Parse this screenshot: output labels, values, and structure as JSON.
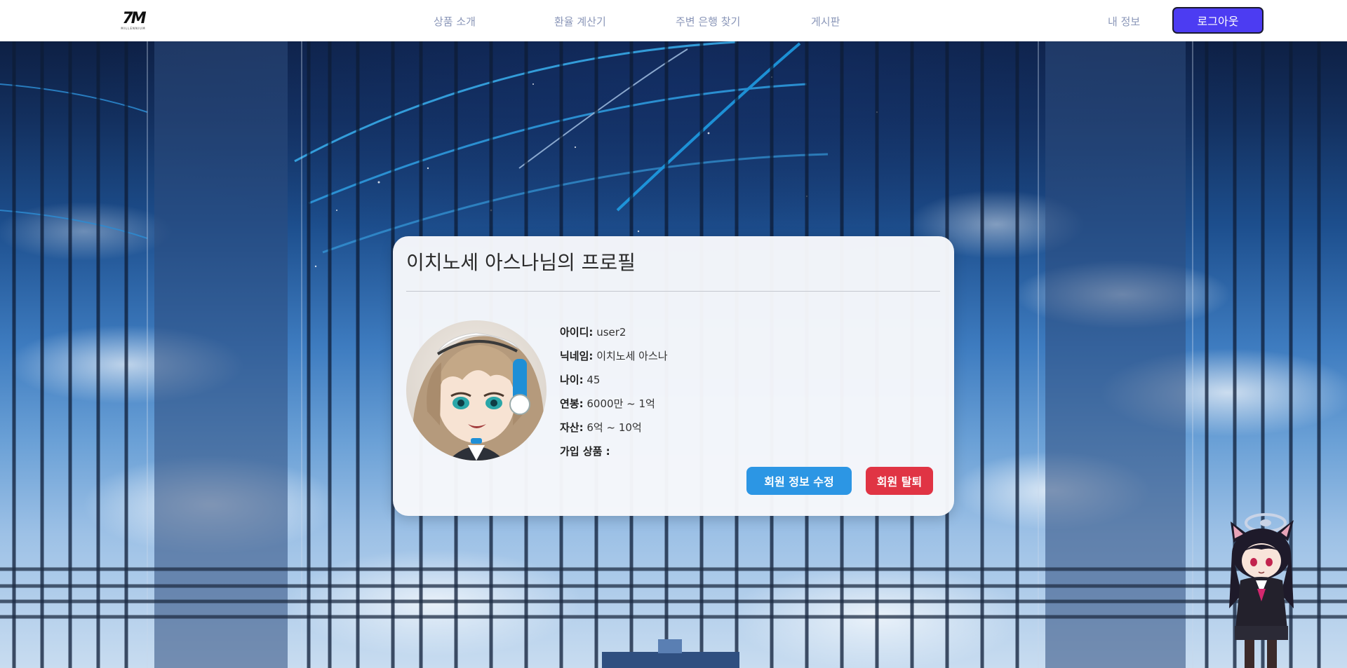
{
  "header": {
    "logo": {
      "mark": "7M",
      "sub": "MILLENNIUM"
    },
    "nav": [
      {
        "label": "상품 소개"
      },
      {
        "label": "환율 계산기"
      },
      {
        "label": "주변 은행 찾기"
      },
      {
        "label": "게시판"
      }
    ],
    "my_info_label": "내 정보",
    "logout_label": "로그아웃"
  },
  "profile": {
    "title": "이치노세 아스나님의 프로필",
    "fields": [
      {
        "label": "아이디:",
        "value": "user2"
      },
      {
        "label": "닉네임:",
        "value": "이치노세 아스나"
      },
      {
        "label": "나이:",
        "value": "45"
      },
      {
        "label": "연봉:",
        "value": "6000만 ~ 1억"
      },
      {
        "label": "자산:",
        "value": "6억 ~ 10억"
      },
      {
        "label": "가입 상품 :",
        "value": ""
      }
    ],
    "edit_label": "회원 정보 수정",
    "delete_label": "회원 탈퇴"
  },
  "colors": {
    "logout_bg": "#4c3cf2",
    "edit_bg": "#2c96e4",
    "delete_bg": "#e03444",
    "nav_text": "#8a96b8"
  }
}
